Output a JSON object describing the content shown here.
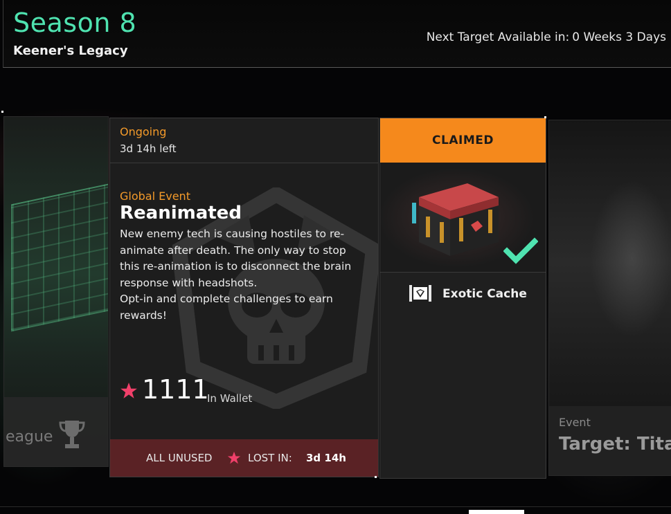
{
  "header": {
    "season_title": "Season 8",
    "season_subtitle": "Keener's Legacy",
    "next_target_label": "Next Target Available in:",
    "next_target_value": "0 Weeks 3 Days"
  },
  "left_card": {
    "label": "eague",
    "icon": "trophy-icon"
  },
  "event_card": {
    "status": "Ongoing",
    "time_left": "3d 14h left",
    "event_type": "Global Event",
    "event_name": "Reanimated",
    "description_lines": [
      "New enemy tech is causing hostiles to re-",
      "animate after death. The only way to stop",
      "this re-animation is to disconnect the brain",
      "response with headshots.",
      "Opt-in and complete challenges to earn",
      "rewards!"
    ],
    "wallet_value": "1111",
    "wallet_label": "In Wallet",
    "footer": {
      "unused_label": "ALL UNUSED",
      "lost_label": "LOST IN:",
      "lost_time": "3d 14h"
    },
    "accent_color": "#f39a2a",
    "star_color": "#f0406a"
  },
  "reward": {
    "status": "CLAIMED",
    "name": "Exotic Cache",
    "icon": "exotic-cache-icon",
    "claimed": true,
    "status_color": "#f5891c",
    "check_color": "#4fe3b0"
  },
  "right_card": {
    "event_label": "Event",
    "target_label": "Target: Titar"
  }
}
